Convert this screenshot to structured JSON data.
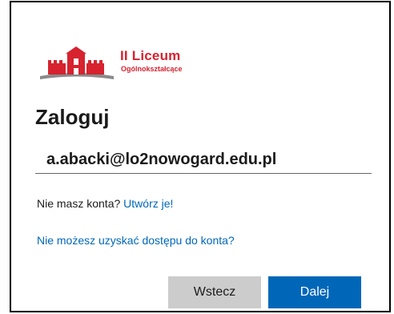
{
  "logo": {
    "name": "II Liceum",
    "subtitle": "Ogólnokształcące",
    "icon": "castle-logo-icon",
    "color": "#d6232f",
    "base_color": "#8a8a8a"
  },
  "signin": {
    "title": "Zaloguj",
    "email_value": "a.abacki@lo2nowogard.edu.pl",
    "no_account_text": "Nie masz konta?",
    "create_link": "Utwórz je!",
    "cant_access_link": "Nie możesz uzyskać dostępu do konta?"
  },
  "buttons": {
    "back_label": "Wstecz",
    "next_label": "Dalej"
  },
  "colors": {
    "accent": "#0067b8",
    "secondary_button": "#cccccc",
    "text": "#1b1b1b"
  }
}
